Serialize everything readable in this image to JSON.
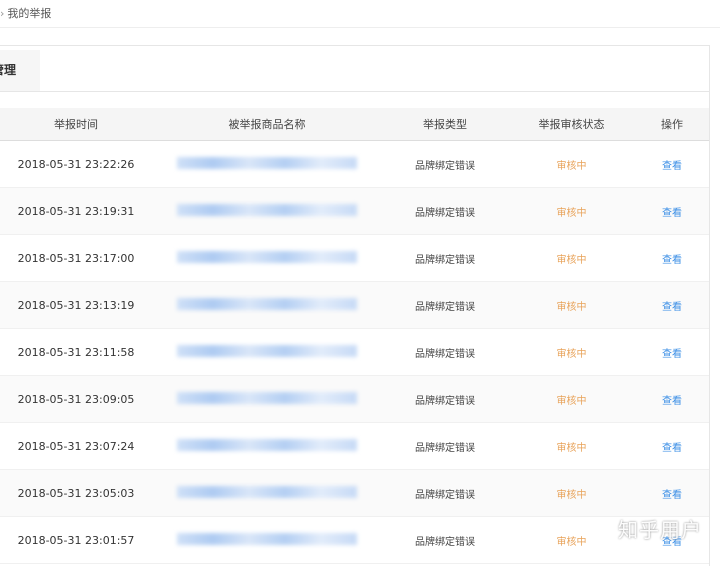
{
  "breadcrumb": {
    "current": "我的举报"
  },
  "tab": {
    "label": "管理"
  },
  "table": {
    "headers": [
      "举报时间",
      "被举报商品名称",
      "举报类型",
      "举报审核状态",
      "操作"
    ],
    "rows": [
      {
        "time": "2018-05-31 23:22:26",
        "type": "品牌绑定错误",
        "status": "审核中",
        "action": "查看"
      },
      {
        "time": "2018-05-31 23:19:31",
        "type": "品牌绑定错误",
        "status": "审核中",
        "action": "查看"
      },
      {
        "time": "2018-05-31 23:17:00",
        "type": "品牌绑定错误",
        "status": "审核中",
        "action": "查看"
      },
      {
        "time": "2018-05-31 23:13:19",
        "type": "品牌绑定错误",
        "status": "审核中",
        "action": "查看"
      },
      {
        "time": "2018-05-31 23:11:58",
        "type": "品牌绑定错误",
        "status": "审核中",
        "action": "查看"
      },
      {
        "time": "2018-05-31 23:09:05",
        "type": "品牌绑定错误",
        "status": "审核中",
        "action": "查看"
      },
      {
        "time": "2018-05-31 23:07:24",
        "type": "品牌绑定错误",
        "status": "审核中",
        "action": "查看"
      },
      {
        "time": "2018-05-31 23:05:03",
        "type": "品牌绑定错误",
        "status": "审核中",
        "action": "查看"
      },
      {
        "time": "2018-05-31 23:01:57",
        "type": "品牌绑定错误",
        "status": "审核中",
        "action": "查看"
      }
    ]
  },
  "watermark": "知乎用户",
  "colors": {
    "status": "#e8a35a",
    "link": "#3a8ee6",
    "header_bg": "#f5f5f5"
  }
}
